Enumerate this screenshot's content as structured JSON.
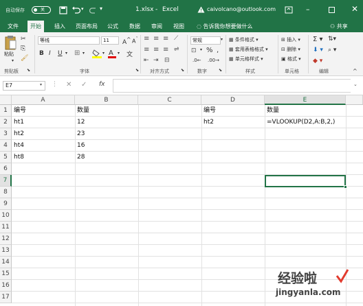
{
  "title_bar": {
    "autosave_label": "自动保存",
    "autosave_toggle": "关",
    "filename": "1.xlsx",
    "separator": "-",
    "app_name": "Excel",
    "account": "caivolcano@outlook.com"
  },
  "ribbon_tabs": [
    "文件",
    "开始",
    "插入",
    "页面布局",
    "公式",
    "数据",
    "审阅",
    "视图"
  ],
  "active_tab": "开始",
  "tell_me": "告诉我你想要做什么",
  "share_label": "共享",
  "ribbon": {
    "paste_label": "粘贴",
    "font_name": "等线",
    "font_size": "11",
    "number_format": "常规",
    "conditional_format": "条件格式",
    "format_as_table": "套用表格格式",
    "cell_styles": "单元格样式",
    "insert": "插入",
    "delete": "删除",
    "format": "格式",
    "groups": [
      "剪贴板",
      "字体",
      "对齐方式",
      "数字",
      "样式",
      "单元格",
      "编辑"
    ]
  },
  "formula_bar": {
    "name_box": "E7",
    "fx": "fx",
    "formula": ""
  },
  "grid": {
    "columns": [
      "A",
      "B",
      "C",
      "D",
      "E"
    ],
    "rows": [
      "1",
      "2",
      "3",
      "4",
      "5",
      "6",
      "7",
      "8",
      "9",
      "10",
      "11",
      "12",
      "13",
      "14",
      "15",
      "16",
      "17"
    ],
    "cells": {
      "A1": "编号",
      "B1": "数量",
      "D1": "编号",
      "E1": "数量",
      "A2": "ht1",
      "B2": "12",
      "D2": "ht2",
      "E2": "=VLOOKUP(D2,A:B,2,)",
      "A3": "ht2",
      "B3": "23",
      "A4": "ht4",
      "B4": "16",
      "A5": "ht8",
      "B5": "28"
    },
    "selected_cell": "E7"
  },
  "watermark": {
    "chinese": "经验啦",
    "url": "jingyanla.com"
  },
  "colors": {
    "accent": "#217346",
    "selection": "#217346"
  }
}
